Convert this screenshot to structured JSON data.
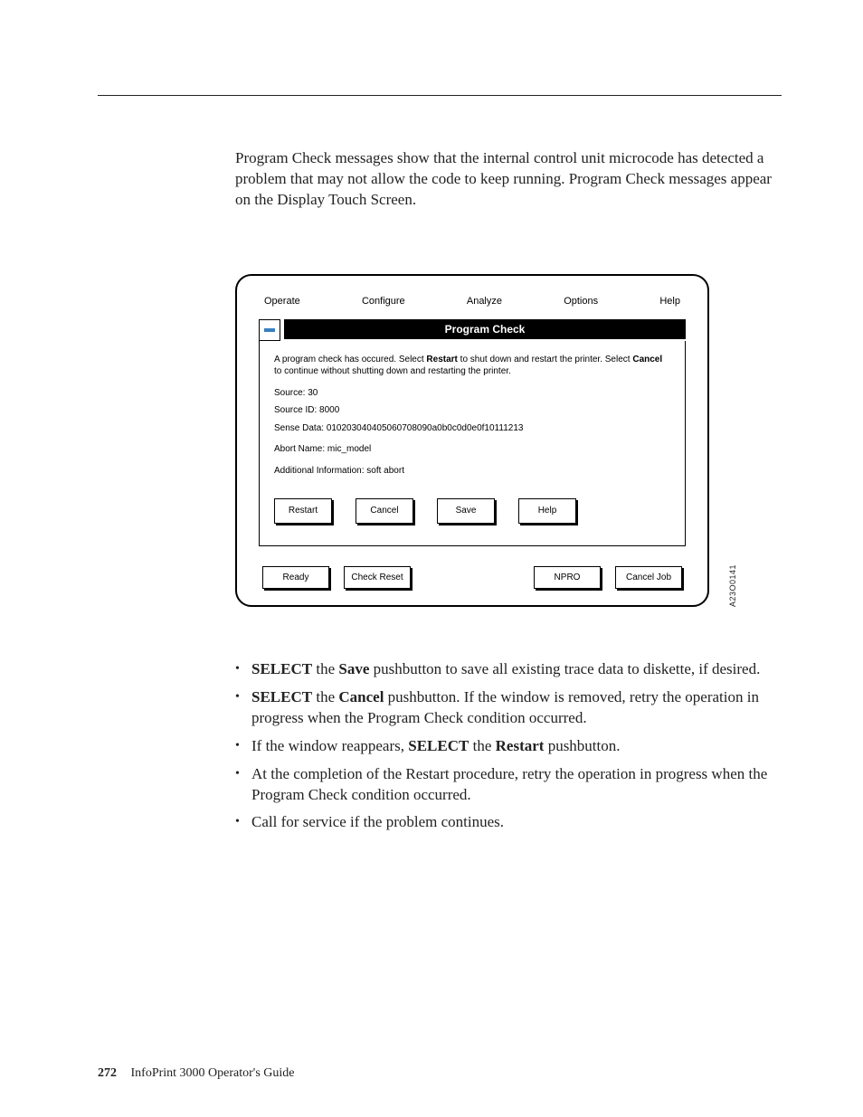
{
  "intro": "Program Check messages show that the internal control unit microcode has detected a problem that may not allow the code to keep running. Program Check messages appear on the Display Touch Screen.",
  "menu": {
    "operate": "Operate",
    "configure": "Configure",
    "analyze": "Analyze",
    "options": "Options",
    "help": "Help"
  },
  "dialog": {
    "title": "Program Check",
    "msg_pre": "A program check has occured. Select ",
    "msg_restart": "Restart",
    "msg_mid": " to shut down and restart the printer.  Select ",
    "msg_cancel": "Cancel",
    "msg_post": " to continue without shutting down and restarting the printer.",
    "source": "Source: 30",
    "source_id": "Source ID: 8000",
    "sense": "Sense Data: 010203040405060708090a0b0c0d0e0f10111213",
    "abort": "Abort Name: mic_model",
    "addl": "Additional Information: soft abort",
    "btn_restart": "Restart",
    "btn_cancel": "Cancel",
    "btn_save": "Save",
    "btn_help": "Help"
  },
  "bottom": {
    "ready": "Ready",
    "check_reset": "Check Reset",
    "npro": "NPRO",
    "cancel_job": "Cancel Job"
  },
  "figure_id": "A23O0141",
  "bullets": {
    "b1a": "SELECT",
    "b1b": " the ",
    "b1c": "Save",
    "b1d": " pushbutton to save all existing trace data to diskette, if desired.",
    "b2a": "SELECT",
    "b2b": " the ",
    "b2c": "Cancel",
    "b2d": " pushbutton. If the window is removed, retry the operation in progress when the Program Check condition occurred.",
    "b3a": "If the window reappears, ",
    "b3b": "SELECT",
    "b3c": " the ",
    "b3d": "Restart",
    "b3e": " pushbutton.",
    "b4": "At the completion of the Restart procedure, retry the operation in progress when the Program Check condition occurred.",
    "b5": "Call for service if the problem continues."
  },
  "footer": {
    "page": "272",
    "title": "InfoPrint 3000 Operator's Guide"
  }
}
